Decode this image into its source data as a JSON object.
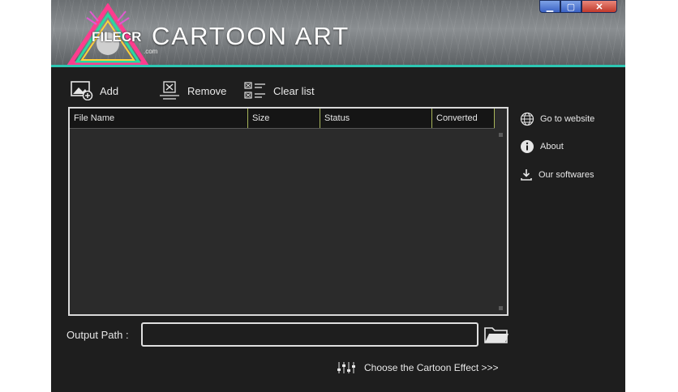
{
  "header": {
    "app_title": "CARTOON ART",
    "logo_text": "FILECR",
    "logo_sub": ".com"
  },
  "window_controls": {
    "minimize": "▁",
    "maximize": "▢",
    "close": "✕"
  },
  "toolbar": {
    "add_label": "Add",
    "remove_label": "Remove",
    "clear_label": "Clear list"
  },
  "file_table": {
    "columns": [
      "File Name",
      "Size",
      "Status",
      "Converted"
    ],
    "rows": []
  },
  "side_links": {
    "website": "Go to website",
    "about": "About",
    "softwares": "Our softwares"
  },
  "output": {
    "label": "Output Path :",
    "value": ""
  },
  "effect": {
    "label": "Choose the Cartoon Effect >>>"
  },
  "colors": {
    "accent": "#2dc7b3",
    "background": "#1e1e1e",
    "table_bg": "#2b2b2b",
    "header_divider": "#a8b65a"
  },
  "icons": {
    "add": "add-image-icon",
    "remove": "remove-icon",
    "clear": "clear-list-icon",
    "website": "globe-icon",
    "about": "info-icon",
    "softwares": "download-icon",
    "folder": "folder-icon",
    "effect": "equalizer-icon"
  }
}
